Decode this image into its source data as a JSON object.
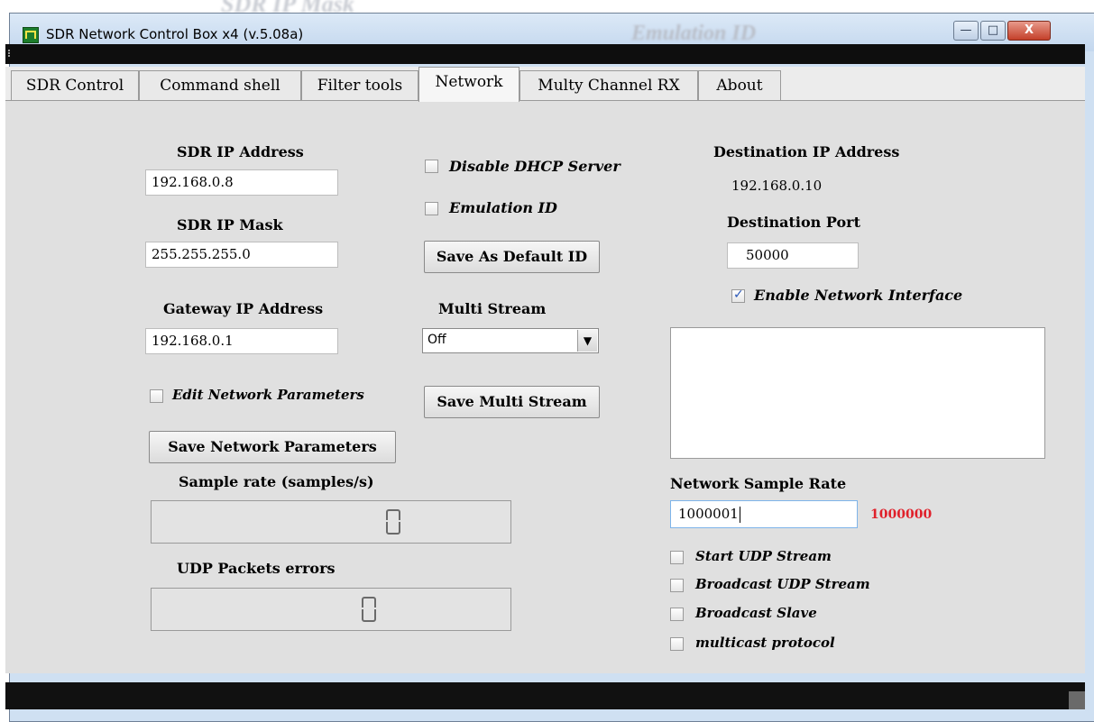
{
  "window": {
    "title": "SDR Network Control Box x4 (v.5.08a)"
  },
  "caption_buttons": {
    "minimize": "—",
    "maximize": "□",
    "close": "X"
  },
  "tabs": [
    {
      "label": "SDR Control"
    },
    {
      "label": "Command shell"
    },
    {
      "label": "Filter tools"
    },
    {
      "label": "Network",
      "active": true
    },
    {
      "label": "Multy Channel RX"
    },
    {
      "label": "About"
    }
  ],
  "network": {
    "sdr_ip_label": "SDR IP Address",
    "sdr_ip_value": "192.168.0.8",
    "sdr_mask_label": "SDR IP Mask",
    "sdr_mask_value": "255.255.255.0",
    "gateway_label": "Gateway IP Address",
    "gateway_value": "192.168.0.1",
    "edit_params_label": "Edit Network Parameters",
    "edit_params_checked": false,
    "save_params_button": "Save Network Parameters",
    "sample_rate_label": "Sample rate (samples/s)",
    "sample_rate_value": "0",
    "udp_errors_label": "UDP Packets errors",
    "udp_errors_value": "0",
    "disable_dhcp_label": "Disable DHCP Server",
    "disable_dhcp_checked": false,
    "emulation_id_label": "Emulation ID",
    "emulation_id_checked": false,
    "save_default_id_button": "Save As Default ID",
    "multi_stream_label": "Multi Stream",
    "multi_stream_value": "Off",
    "save_multi_stream_button": "Save Multi Stream",
    "dest_ip_label": "Destination IP Address",
    "dest_ip_value": "192.168.0.10",
    "dest_port_label": "Destination Port",
    "dest_port_value": "50000",
    "enable_net_label": "Enable Network Interface",
    "enable_net_checked": true,
    "net_sample_rate_label": "Network Sample Rate",
    "net_sample_rate_input": "1000001",
    "net_sample_rate_actual": "1000000",
    "start_udp_label": "Start UDP Stream",
    "broadcast_udp_label": "Broadcast UDP Stream",
    "broadcast_slave_label": "Broadcast Slave",
    "multicast_label": "multicast protocol"
  },
  "background_remnants": {
    "text1": "SDR IP Mask",
    "text2": "Emulation ID"
  },
  "colors": {
    "titlebar": "#cfe0f2",
    "panel": "#e0e0e0",
    "actual_rate": "#e0202a",
    "check": "#2a58b8"
  }
}
